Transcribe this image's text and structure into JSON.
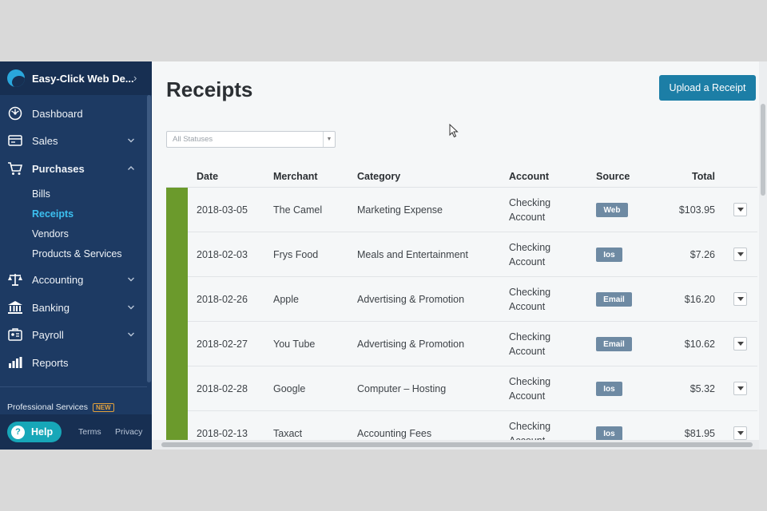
{
  "sidebar": {
    "company_name": "Easy-Click Web De...",
    "nav": [
      {
        "label": "Dashboard",
        "icon": "dashboard-icon",
        "chevron": ""
      },
      {
        "label": "Sales",
        "icon": "sales-card-icon",
        "chevron": "down"
      },
      {
        "label": "Purchases",
        "icon": "shopping-cart-icon",
        "chevron": "up"
      },
      {
        "label": "Accounting",
        "icon": "scales-icon",
        "chevron": "down"
      },
      {
        "label": "Banking",
        "icon": "bank-icon",
        "chevron": "down"
      },
      {
        "label": "Payroll",
        "icon": "payroll-icon",
        "chevron": "down"
      },
      {
        "label": "Reports",
        "icon": "bar-chart-icon",
        "chevron": ""
      }
    ],
    "purchases_sub": [
      {
        "label": "Bills",
        "active": false
      },
      {
        "label": "Receipts",
        "active": true
      },
      {
        "label": "Vendors",
        "active": false
      },
      {
        "label": "Products & Services",
        "active": false
      }
    ],
    "professional_services": "Professional Services",
    "new_badge": "NEW",
    "help_label": "Help",
    "help_glyph": "?",
    "terms": "Terms",
    "privacy": "Privacy"
  },
  "main": {
    "title": "Receipts",
    "upload_button": "Upload a Receipt",
    "status_filter": {
      "value": "All Statuses"
    }
  },
  "table": {
    "headers": [
      "Date",
      "Merchant",
      "Category",
      "Account",
      "Source",
      "Total"
    ],
    "rows": [
      {
        "date": "2018-03-05",
        "merchant": "The Camel",
        "category": "Marketing Expense",
        "account_line1": "Checking",
        "account_line2": "Account",
        "source": "Web",
        "total": "$103.95"
      },
      {
        "date": "2018-02-03",
        "merchant": "Frys Food",
        "category": "Meals and Entertainment",
        "account_line1": "Checking",
        "account_line2": "Account",
        "source": "Ios",
        "total": "$7.26"
      },
      {
        "date": "2018-02-26",
        "merchant": "Apple",
        "category": "Advertising & Promotion",
        "account_line1": "Checking",
        "account_line2": "Account",
        "source": "Email",
        "total": "$16.20"
      },
      {
        "date": "2018-02-27",
        "merchant": "You Tube",
        "category": "Advertising & Promotion",
        "account_line1": "Checking",
        "account_line2": "Account",
        "source": "Email",
        "total": "$10.62"
      },
      {
        "date": "2018-02-28",
        "merchant": "Google",
        "category": "Computer – Hosting",
        "account_line1": "Checking",
        "account_line2": "Account",
        "source": "Ios",
        "total": "$5.32"
      },
      {
        "date": "2018-02-13",
        "merchant": "Taxact",
        "category": "Accounting Fees",
        "account_line1": "Checking",
        "account_line2": "Account",
        "source": "Ios",
        "total": "$81.95"
      }
    ]
  },
  "colors": {
    "sidebar_bg": "#1d3a63",
    "active_link": "#3cc0f0",
    "primary_button": "#1c7ea6",
    "row_stripe": "#6b9a2c",
    "source_badge": "#6e8aa3",
    "help_button": "#17a7b8"
  }
}
